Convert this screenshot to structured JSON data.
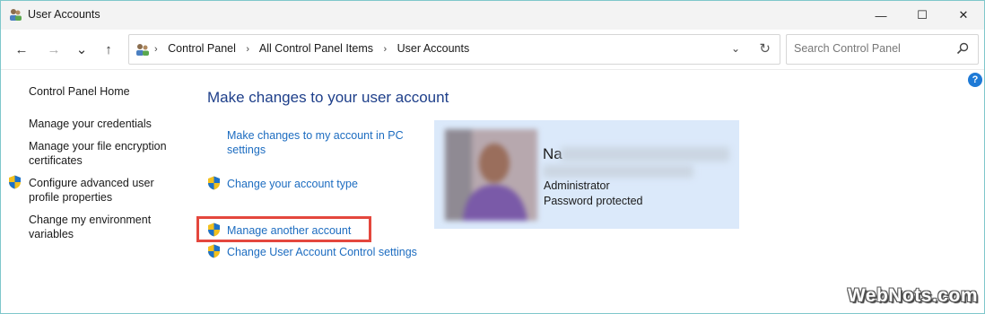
{
  "window": {
    "title": "User Accounts",
    "controls": {
      "minimize": "—",
      "maximize": "☐",
      "close": "✕"
    }
  },
  "nav": {
    "back": "←",
    "forward": "→",
    "recent": "⌄",
    "up": "↑",
    "breadcrumb": [
      "Control Panel",
      "All Control Panel Items",
      "User Accounts"
    ],
    "separator": "›",
    "dropdown": "⌄",
    "refresh": "↻"
  },
  "search": {
    "placeholder": "Search Control Panel"
  },
  "help": {
    "label": "?"
  },
  "sidebar": {
    "items": [
      {
        "label": "Control Panel Home",
        "shield": false
      },
      {
        "label": "Manage your credentials",
        "shield": false
      },
      {
        "label": "Manage your file encryption certificates",
        "shield": false
      },
      {
        "label": "Configure advanced user profile properties",
        "shield": true
      },
      {
        "label": "Change my environment variables",
        "shield": false
      }
    ]
  },
  "main": {
    "title": "Make changes to your user account",
    "tasks": [
      {
        "label": "Make changes to my account in PC settings",
        "shield": false
      },
      {
        "label": "Change your account type",
        "shield": true
      },
      {
        "label": "Manage another account",
        "shield": true,
        "highlighted": true
      },
      {
        "label": "Change User Account Control settings",
        "shield": true
      }
    ]
  },
  "account": {
    "name_visible": "Na",
    "role": "Administrator",
    "status": "Password protected"
  },
  "watermark": "WebNots.com",
  "colors": {
    "link": "#1c6cc0",
    "heading": "#1e3f8a",
    "card": "#dbe9fa",
    "highlight": "#e4473d",
    "accent": "#1fa2a8"
  }
}
